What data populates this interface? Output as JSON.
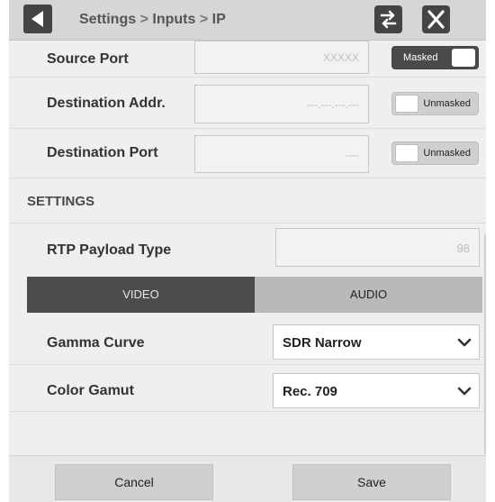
{
  "header": {
    "breadcrumb": [
      "Settings",
      "Inputs",
      "IP"
    ],
    "separator": ">"
  },
  "fields": {
    "source_port": {
      "label": "Source Port",
      "value": "XXXXX",
      "toggle": "Masked"
    },
    "destination_addr": {
      "label": "Destination Addr.",
      "value": "---.---.---.---",
      "toggle": "Unmasked"
    },
    "destination_port": {
      "label": "Destination Port",
      "value": "----",
      "toggle": "Unmasked"
    }
  },
  "settings": {
    "section_title": "SETTINGS",
    "rtp_payload_type": {
      "label": "RTP Payload Type",
      "value": "98"
    },
    "tabs": {
      "video": "VIDEO",
      "audio": "AUDIO"
    },
    "gamma_curve": {
      "label": "Gamma Curve",
      "value": "SDR Narrow"
    },
    "color_gamut": {
      "label": "Color Gamut",
      "value": "Rec. 709"
    }
  },
  "footer": {
    "cancel_label": "Cancel",
    "save_label": "Save"
  },
  "icons": {
    "back": "triangle-left-icon",
    "swap": "swap-arrows-icon",
    "close": "close-x-icon",
    "dropdown": "chevron-down-icon"
  },
  "colors": {
    "header_bg": "#d6d6d6",
    "button_dark": "#444444",
    "tab_active": "#4c4c4c"
  }
}
